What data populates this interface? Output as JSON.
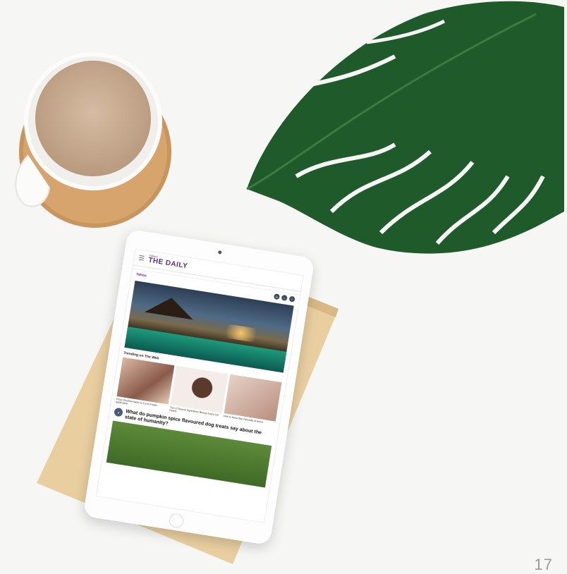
{
  "scene": {
    "background_color": "#f6f6f5",
    "page_number": "17"
  },
  "tablet": {
    "app": {
      "logo_small": "Yahoo!",
      "logo": "THE DAILY",
      "nav_items": [
        "",
        "",
        "",
        ""
      ]
    },
    "brand_label": "Yahoo",
    "social_icons": [
      "linkedin-icon",
      "twitter-icon",
      "facebook-icon"
    ],
    "section_title": "Trending on The Web",
    "cards": [
      {
        "text": "8 Eye Shadow Hacks to Try for Easier Application"
      },
      {
        "text": "The 12 Natural Ingredients Beauty Every Girl Needs"
      },
      {
        "text": "How to Keep Skin Naturally at Home"
      }
    ],
    "headline": "What do pumpkin spice flavoured dog treats say about the state of humanity?"
  }
}
